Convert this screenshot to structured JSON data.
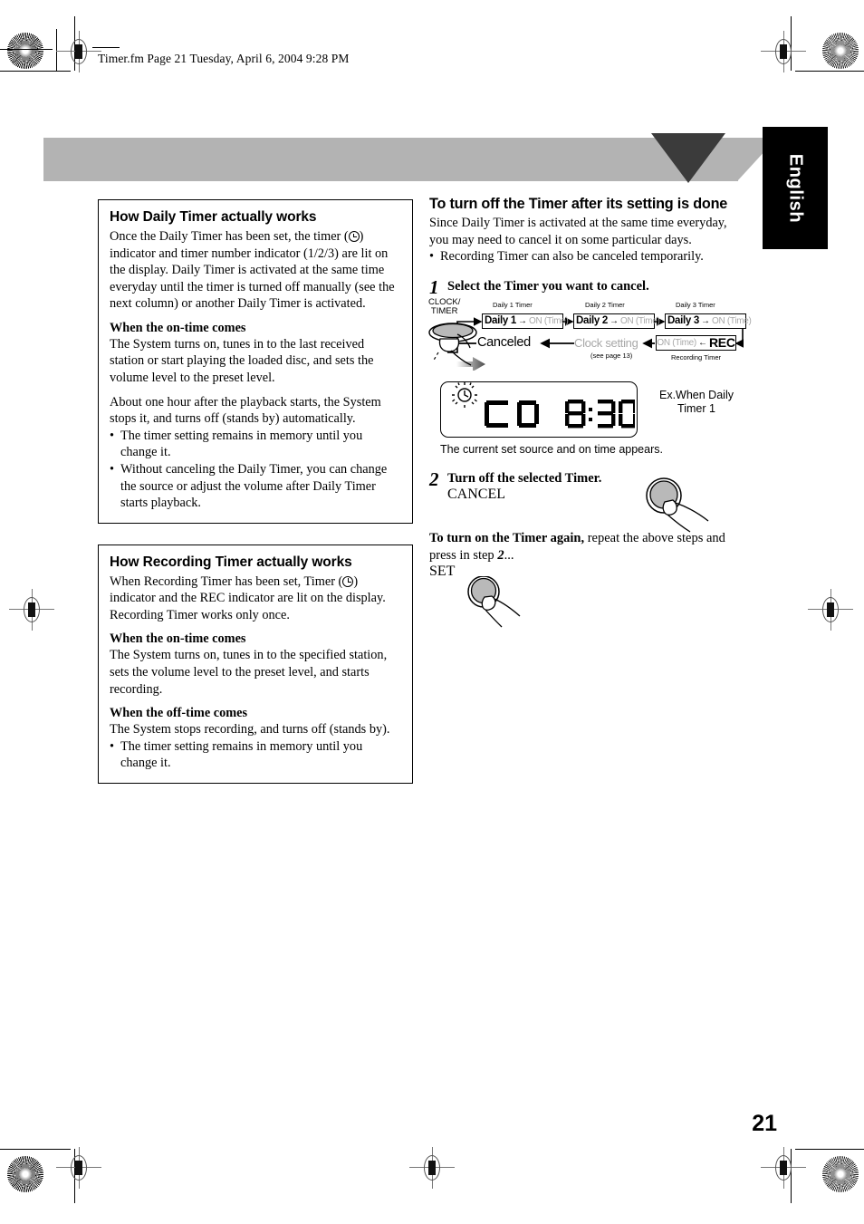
{
  "header": {
    "file_line": "Timer.fm  Page 21  Tuesday, April 6, 2004  9:28 PM"
  },
  "language_tab": {
    "label": "English"
  },
  "left_column": {
    "box_daily": {
      "title": "How Daily Timer actually works",
      "intro_part1": "Once the Daily Timer has been set, the timer (",
      "intro_part2": ") indicator and timer number indicator (1/2/3) are lit on the display. Daily Timer is activated at the same time everyday until the timer is turned off manually (see the next column) or another Daily Timer is activated.",
      "on_time_heading": "When the on-time comes",
      "on_time_text": "The System turns on, tunes in to the last received station or start playing the loaded disc, and sets the volume level to the preset level.",
      "auto_off_text": "About one hour after the playback starts, the System stops it, and turns off (stands by) automatically.",
      "bullets": [
        "The timer setting remains in memory until you change it.",
        "Without canceling the Daily Timer, you can change the source or adjust the volume after Daily Timer starts playback."
      ]
    },
    "box_recording": {
      "title": "How Recording Timer actually works",
      "intro_part1": "When Recording Timer has been set, Timer (",
      "intro_part2": ") indicator and the REC indicator are lit on the display. Recording Timer works only once.",
      "on_time_heading": "When the on-time comes",
      "on_time_text": "The System turns on, tunes in to the specified station, sets the volume level to the preset level, and starts recording.",
      "off_time_heading": "When the off-time comes",
      "off_time_text": "The System stops recording, and turns off (stands by).",
      "bullets": [
        "The timer setting remains in memory until you change it."
      ]
    }
  },
  "right_column": {
    "section_title": "To turn off the Timer after its setting is done",
    "intro": "Since Daily Timer is activated at the same time everyday, you may need to cancel it on some particular days.",
    "intro_bullet": "Recording Timer can also be canceled temporarily.",
    "step1": {
      "number": "1",
      "text": "Select the Timer you want to cancel."
    },
    "flow_diagram": {
      "button_label_line1": "CLOCK/",
      "button_label_line2": "TIMER",
      "captions": {
        "daily1": "Daily 1 Timer",
        "daily2": "Daily 2 Timer",
        "daily3": "Daily 3 Timer",
        "recording": "Recording Timer"
      },
      "cells": [
        {
          "label": "Daily 1",
          "arrow": "→",
          "dim": "ON (Time)"
        },
        {
          "label": "Daily 2",
          "arrow": "→",
          "dim": "ON (Time)"
        },
        {
          "label": "Daily 3",
          "arrow": "→",
          "dim": "ON (Time)"
        }
      ],
      "rec_cell": {
        "dim": "ON (Time)",
        "arrow": "←",
        "label": "REC"
      },
      "canceled_text": "Canceled",
      "clock_setting_text": "Clock setting",
      "clock_setting_page_ref": "(see page 13)"
    },
    "display": {
      "source": "CD",
      "time": "8:30",
      "note_line1": "Ex.When Daily",
      "note_line2": "Timer 1",
      "caption": "The current set source and on time appears."
    },
    "step2": {
      "number": "2",
      "text": "Turn off the selected Timer.",
      "button_label": "CANCEL"
    },
    "turn_on_again": {
      "bold_lead": "To turn on the Timer again,",
      "rest": " repeat the above steps and press in step ",
      "step_ref": "2",
      "ellipsis": "...",
      "button_label": "SET"
    }
  },
  "footer": {
    "page_number": "21"
  }
}
